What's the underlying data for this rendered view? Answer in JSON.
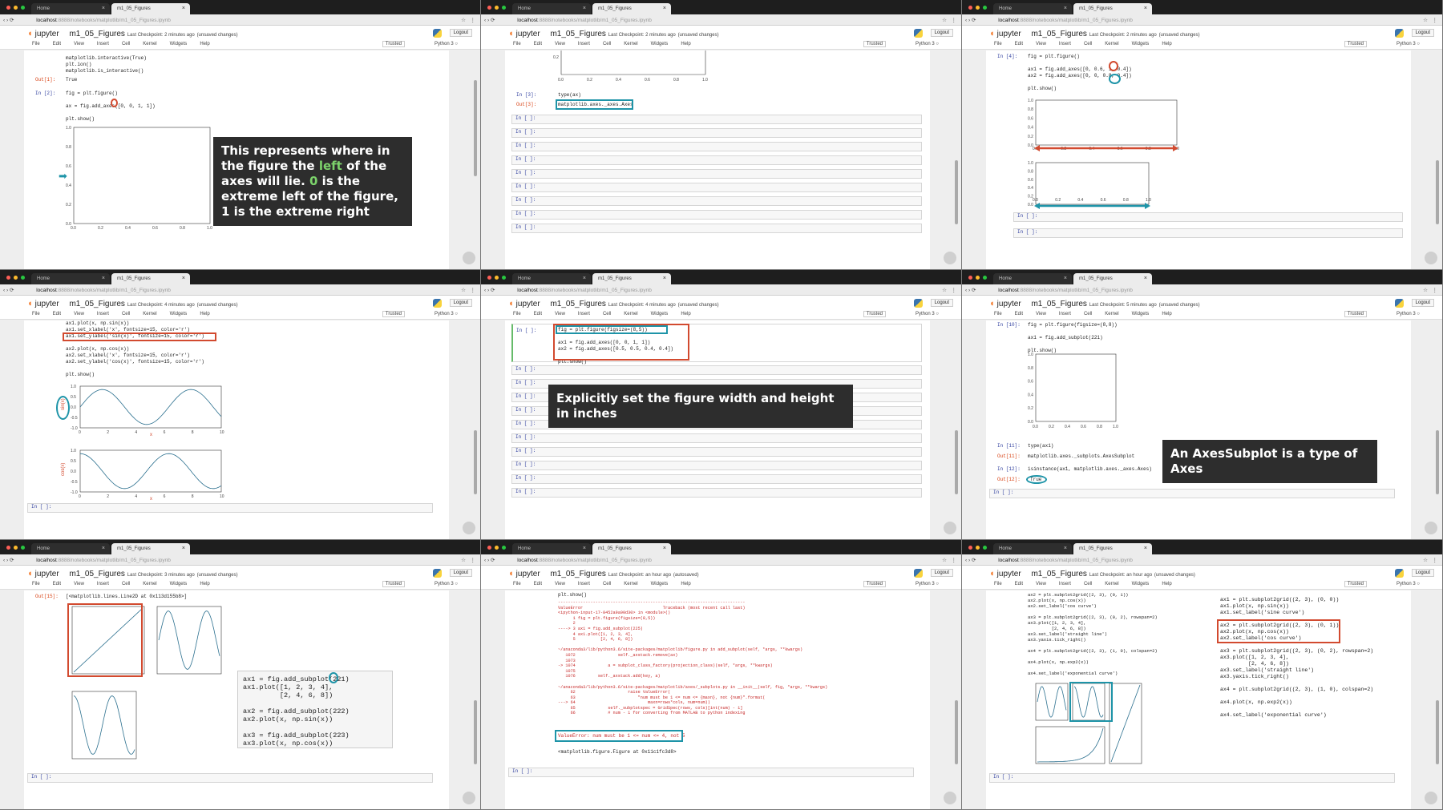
{
  "browser": {
    "tab_home": "Home",
    "tab_nb": "m1_05_Figures",
    "close": "×",
    "url_host": "localhost",
    "url_path": ":8888/notebooks/matplotlib/m1_05_Figures.ipynb",
    "star": "☆",
    "menu": "⋮"
  },
  "jupyter": {
    "logo": "◖",
    "brand": "jupyter",
    "title": "m1_05_Figures",
    "logout": "Logout",
    "menu": [
      "File",
      "Edit",
      "View",
      "Insert",
      "Cell",
      "Kernel",
      "Widgets",
      "Help"
    ],
    "trusted": "Trusted",
    "kernel": "Python 3 ○"
  },
  "panels": [
    {
      "checkpoint": "Last Checkpoint: 2 minutes ago",
      "status": "(unsaved changes)"
    },
    {
      "checkpoint": "Last Checkpoint: 2 minutes ago",
      "status": "(unsaved changes)"
    },
    {
      "checkpoint": "Last Checkpoint: 2 minutes ago",
      "status": "(unsaved changes)"
    },
    {
      "checkpoint": "Last Checkpoint: 4 minutes ago",
      "status": "(unsaved changes)"
    },
    {
      "checkpoint": "Last Checkpoint: 4 minutes ago",
      "status": "(unsaved changes)"
    },
    {
      "checkpoint": "Last Checkpoint: 5 minutes ago",
      "status": "(unsaved changes)"
    },
    {
      "checkpoint": "Last Checkpoint: 3 minutes ago",
      "status": "(unsaved changes)"
    },
    {
      "checkpoint": "Last Checkpoint: an hour ago",
      "status": "(autosaved)"
    },
    {
      "checkpoint": "Last Checkpoint: an hour ago",
      "status": "(unsaved changes)"
    }
  ],
  "p1": {
    "code_top": "matplotlib.interactive(True)\nplt.ion()\nmatplotlib.is_interactive()",
    "out1_prompt": "Out[1]:",
    "out1": "True",
    "in2_prompt": "In [2]:",
    "in2": "fig = plt.figure()\n\nax = fig.add_axes([0, 0, 1, 1])\n\nplt.show()",
    "caption_pre": "This represents where in the figure the ",
    "caption_hl": "left",
    "caption_mid": " of the axes will lie. ",
    "caption_hl2": "0",
    "caption_post": " is the extreme left of the figure, 1 is the extreme right",
    "yticks": [
      "1.0",
      "0.8",
      "0.6",
      "0.4",
      "0.2",
      "0.0"
    ],
    "xticks": [
      "0.0",
      "0.2",
      "0.4",
      "0.6",
      "0.8",
      "1.0"
    ]
  },
  "p2": {
    "in3_prompt": "In [3]:",
    "in3": "type(ax)",
    "out3_prompt": "Out[3]:",
    "out3": "matplotlib.axes._axes.Axes",
    "empty_prompt": "In [ ]:",
    "ytick": "0.2",
    "xticks": [
      "0.0",
      "0.2",
      "0.4",
      "0.6",
      "0.8",
      "1.0"
    ]
  },
  "p3": {
    "in_prompt": "In [4]:",
    "code": "fig = plt.figure()\n\nax1 = fig.add_axes([0, 0.6, 1, 0.4])\nax2 = fig.add_axes([0, 0, 0.8, 0.4])\n\nplt.show()",
    "yticks": [
      "1.0",
      "0.8",
      "0.6",
      "0.4",
      "0.2",
      "0.0"
    ],
    "xticks": [
      "0.0",
      "0.2",
      "0.4",
      "0.6",
      "0.8",
      "1.0"
    ],
    "empty_prompt": "In [ ]:"
  },
  "p4": {
    "code": "ax1.plot(x, np.sin(x))\nax1.set_xlabel('x', fontsize=15, color='r')\nax1.set_ylabel('sin(x)', fontsize=15, color='r')\n\nax2.plot(x, np.cos(x))\nax2.set_xlabel('x', fontsize=15, color='r')\nax2.set_ylabel('cos(x)', fontsize=15, color='r')\n\nplt.show()",
    "ylabel1": "sin(x)",
    "ylabel2": "cos(x)",
    "xlabel": "x",
    "yticks": [
      "1.0",
      "0.5",
      "0.0",
      "-0.5",
      "-1.0"
    ],
    "xticks": [
      "0",
      "2",
      "4",
      "6",
      "8",
      "10"
    ],
    "empty_prompt": "In [ ]:"
  },
  "p5": {
    "in_prompt": "In [ ]:",
    "code": "fig = plt.figure(figsize=(8,5))\n\nax1 = fig.add_axes([0, 0, 1, 1])\nax2 = fig.add_axes([0.5, 0.5, 0.4, 0.4])\n\nplt.show()",
    "caption": "Explicitly set the figure width and height in inches",
    "empty_prompt": "In [ ]:"
  },
  "p6": {
    "in10_prompt": "In [10]:",
    "code": "fig = plt.figure(figsize=(8,8))\n\nax1 = fig.add_subplot(221)\n\nplt.show()",
    "in11_prompt": "In [11]:",
    "in11": "type(ax1)",
    "out11_prompt": "Out[11]:",
    "out11": "matplotlib.axes._subplots.AxesSubplot",
    "in12_prompt": "In [12]:",
    "in12": "isinstance(ax1, matplotlib.axes._axes.Axes)",
    "out12_prompt": "Out[12]:",
    "out12": "True",
    "caption": "An AxesSubplot is a type of Axes",
    "yticks": [
      "1.0",
      "0.8",
      "0.6",
      "0.4",
      "0.2",
      "0.0"
    ],
    "xticks": [
      "0.0",
      "0.2",
      "0.4",
      "0.6",
      "0.8",
      "1.0"
    ],
    "empty_prompt": "In [ ]:"
  },
  "p7": {
    "out_prompt": "Out[15]:",
    "out": "[<matplotlib.lines.Line2D at 0x113d155b8>]",
    "codebox": "ax1 = fig.add_subplot(221)\nax1.plot([1, 2, 3, 4],\n         [2, 4, 6, 8])\n\nax2 = fig.add_subplot(222)\nax2.plot(x, np.sin(x))\n\nax3 = fig.add_subplot(223)\nax3.plot(x, np.cos(x))",
    "empty_prompt": "In [ ]:"
  },
  "p8": {
    "top": "plt.show()",
    "trace": "---------------------------------------------------------------------------\nValueError                                Traceback (most recent call last)\n<ipython-input-17-8452a9a90d30> in <module>()\n      1 fig = plt.figure(figsize=(8,5))\n      2\n----> 3 ax1 = fig.add_subplot(225)\n      4 ax1.plot([1, 2, 3, 4],\n      5          [2, 4, 6, 8])\n\n~/anaconda3/lib/python3.6/site-packages/matplotlib/figure.py in add_subplot(self, *args, **kwargs)\n   1072                 self._axstack.remove(ax)\n   1073\n-> 1074             a = subplot_class_factory(projection_class)(self, *args, **kwargs)\n   1075\n   1076         self._axstack.add(key, a)\n\n~/anaconda3/lib/python3.6/site-packages/matplotlib/axes/_subplots.py in __init__(self, fig, *args, **kwargs)\n     62                     raise ValueError(\n     63                         \"num must be 1 <= num <= {maxn}, not {num}\".format(\n---> 64                             maxn=rows*cols, num=num))\n     65             self._subplotspec = GridSpec(rows, cols)[int(num) - 1]\n     66             # num - 1 for converting from MATLAB to python indexing",
    "error": "ValueError: num must be 1 <= num <= 4, not 5",
    "figure": "<matplotlib.figure.Figure at 0x11c1fc3d8>",
    "empty_prompt": "In [ ]:"
  },
  "p9": {
    "left_code": "ax2 = plt.subplot2grid((2, 3), (0, 1))\nax2.plot(x, np.cos(x))\nax2.set_label('cos curve')\n\nax3 = plt.subplot2grid((2, 3), (0, 2), rowspan=2)\nax3.plot([1, 2, 3, 4],\n         [2, 4, 6, 8])\nax3.set_label('straight line')\nax3.yaxis.tick_right()\n\nax4 = plt.subplot2grid((2, 3), (1, 0), colspan=2)\n\nax4.plot(x, np.exp2(x))\n\nax4.set_label('exponential curve')",
    "right_code1": "ax1 = plt.subplot2grid((2, 3), (0, 0))\nax1.plot(x, np.sin(x))\nax1.set_label('sine curve')",
    "right_code2": "ax2 = plt.subplot2grid((2, 3), (0, 1))\nax2.plot(x, np.cos(x))\nax2.set_label('cos curve')",
    "right_code3": "ax3 = plt.subplot2grid((2, 3), (0, 2), rowspan=2)\nax3.plot([1, 2, 3, 4],\n         [2, 4, 6, 8])\nax3.set_label('straight line')\nax3.yaxis.tick_right()\n\nax4 = plt.subplot2grid((2, 3), (1, 0), colspan=2)\n\nax4.plot(x, np.exp2(x))\n\nax4.set_label('exponential curve')",
    "empty_prompt": "In [ ]:"
  },
  "colors": {
    "red": "#d24a2f",
    "teal": "#1e94a8",
    "line": "#2a6f8e",
    "green": "#7cd36b"
  }
}
